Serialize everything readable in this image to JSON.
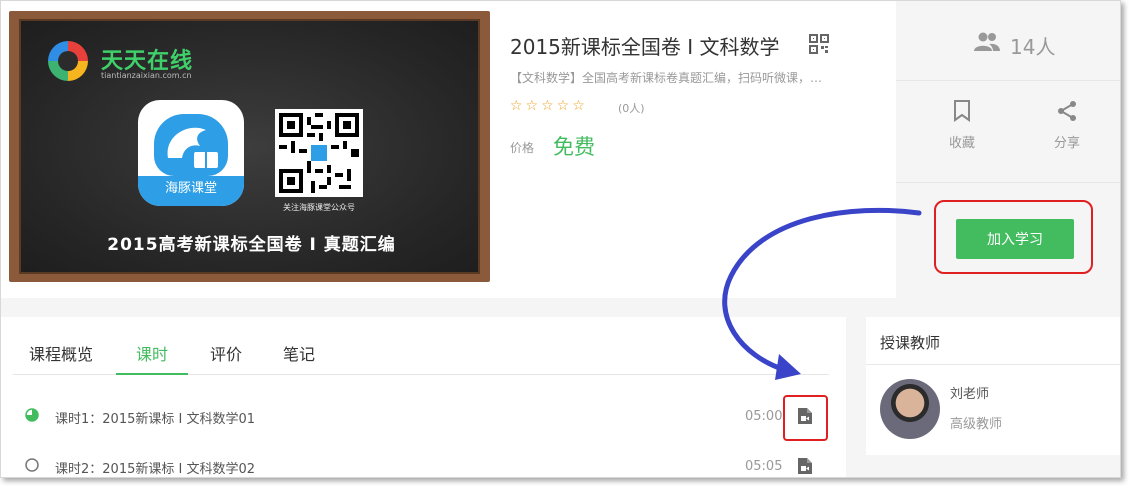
{
  "course": {
    "cover_logo_text": "天天在线",
    "cover_logo_sub": "tiantianzaixian.com.cn",
    "cover_app_label": "海豚课堂",
    "cover_qr_caption": "关注海豚课堂公众号",
    "cover_title": "2015高考新课标全国卷 I 真题汇编",
    "title": "2015新课标全国卷 I 文科数学",
    "description": "【文科数学】全国高考新课标卷真题汇编，扫码听微课，…",
    "stars": "☆☆☆☆☆",
    "rating_count": "(0人)",
    "price_label": "价格",
    "price_value": "免费"
  },
  "side": {
    "student_count": "14人",
    "favorite_label": "收藏",
    "share_label": "分享",
    "join_button": "加入学习"
  },
  "tabs": [
    {
      "label": "课程概览"
    },
    {
      "label": "课时"
    },
    {
      "label": "评价"
    },
    {
      "label": "笔记"
    }
  ],
  "active_tab": "课时",
  "lessons": [
    {
      "title": "课时1：2015新课标 I 文科数学01",
      "duration": "05:00",
      "status": "in-progress"
    },
    {
      "title": "课时2：2015新课标 I 文科数学02",
      "duration": "05:05",
      "status": "not-started"
    }
  ],
  "teacher": {
    "heading": "授课教师",
    "name": "刘老师",
    "title": "高级教师"
  },
  "colors": {
    "accent_green": "#43bc60",
    "highlight_red": "#e02020",
    "arrow_blue": "#3a44c8",
    "star_orange": "#f0a020"
  },
  "icons": {
    "students": "people-icon",
    "favorite": "bookmark-icon",
    "share": "share-icon",
    "qr": "qr-code-icon",
    "lesson_video": "video-file-icon"
  }
}
